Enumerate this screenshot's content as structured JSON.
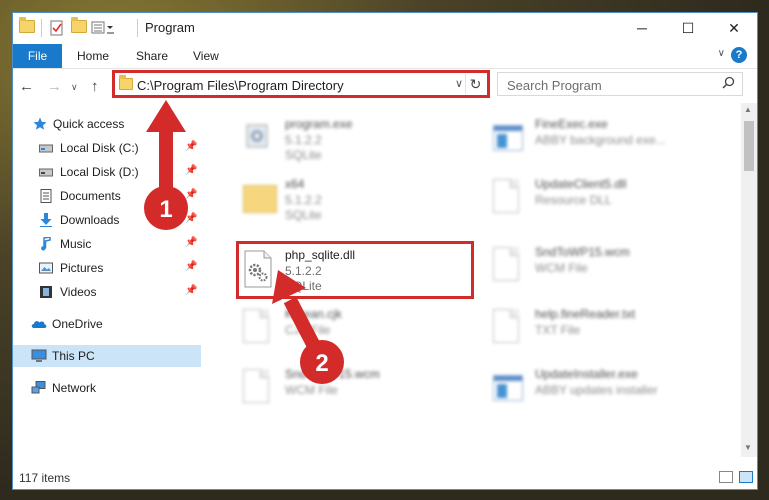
{
  "window": {
    "title": "Program",
    "controls": {
      "minimize": "─",
      "maximize": "☐",
      "close": "✕"
    }
  },
  "ribbon": {
    "tabs": [
      {
        "label": "File"
      },
      {
        "label": "Home"
      },
      {
        "label": "Share"
      },
      {
        "label": "View"
      }
    ],
    "help": "?"
  },
  "address": {
    "path": "C:\\Program Files\\Program Directory",
    "refresh": "↻"
  },
  "search": {
    "placeholder": "Search Program"
  },
  "sidebar": {
    "quick_access": "Quick access",
    "items": [
      {
        "label": "Local Disk (C:)"
      },
      {
        "label": "Local Disk (D:)"
      },
      {
        "label": "Documents"
      },
      {
        "label": "Downloads"
      },
      {
        "label": "Music"
      },
      {
        "label": "Pictures"
      },
      {
        "label": "Videos"
      }
    ],
    "onedrive": "OneDrive",
    "thispc": "This PC",
    "network": "Network"
  },
  "files": [
    {
      "name": "program.exe",
      "line1": "5.1.2.2",
      "line2": "SQLite"
    },
    {
      "name": "FineExec.exe",
      "line1": "ABBY background exe...",
      "line2": ""
    },
    {
      "name": "x64",
      "line1": "5.1.2.2",
      "line2": "SQLite"
    },
    {
      "name": "UpdateClient5.dll",
      "line1": "Resource DLL",
      "line2": ""
    },
    {
      "name": "php_sqlite.dll",
      "line1": "5.1.2.2",
      "line2": "SQLite"
    },
    {
      "name": "SndToWP15.wcm",
      "line1": "WCM File",
      "line2": ""
    },
    {
      "name": "Korean.cjk",
      "line1": "CJK File",
      "line2": ""
    },
    {
      "name": "help.fineReader.txt",
      "line1": "TXT File",
      "line2": ""
    },
    {
      "name": "SndToWP15.wcm",
      "line1": "WCM File",
      "line2": ""
    },
    {
      "name": "UpdateInstaller.exe",
      "line1": "ABBY updates installer",
      "line2": ""
    }
  ],
  "status": {
    "item_count": "117 items"
  },
  "annotations": {
    "badge1": "1",
    "badge2": "2"
  },
  "colors": {
    "accent": "#1979ca",
    "highlight": "#d32a2a",
    "selection": "#cce4f7"
  }
}
